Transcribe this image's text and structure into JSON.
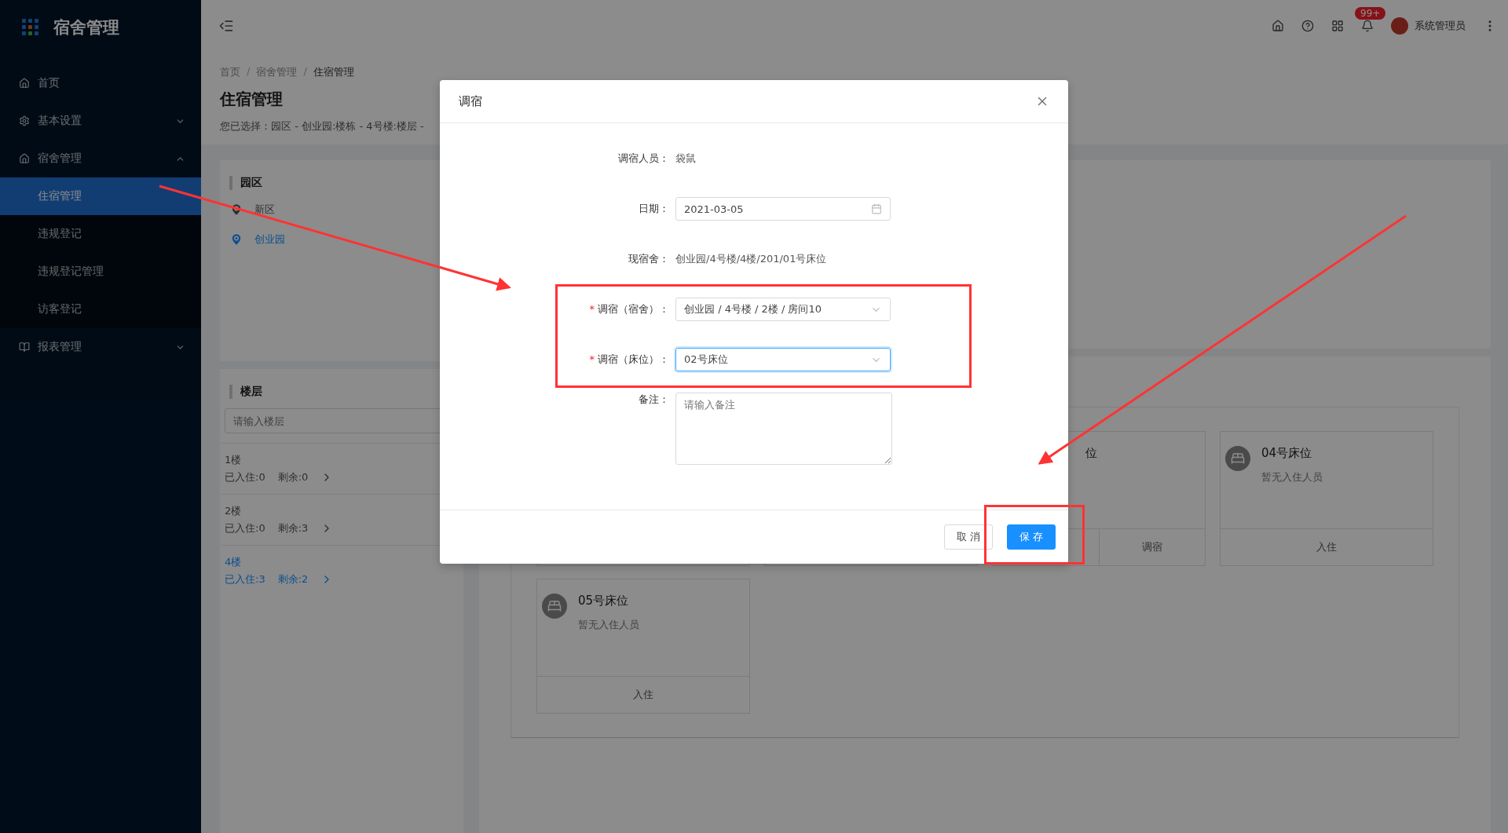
{
  "app": {
    "title": "宿舍管理"
  },
  "sidebar": {
    "items": [
      {
        "label": "首页"
      },
      {
        "label": "基本设置",
        "expanded": false
      },
      {
        "label": "宿舍管理",
        "expanded": true,
        "children": [
          {
            "label": "住宿管理",
            "selected": true
          },
          {
            "label": "违规登记",
            "selected": false
          },
          {
            "label": "违规登记管理",
            "selected": false
          },
          {
            "label": "访客登记",
            "selected": false
          }
        ]
      },
      {
        "label": "报表管理",
        "expanded": false
      }
    ]
  },
  "header": {
    "badge": "99+",
    "user": "系统管理员"
  },
  "breadcrumb": {
    "separator": "/",
    "items": [
      "首页",
      "宿舍管理",
      "住宿管理"
    ]
  },
  "page": {
    "title": "住宿管理",
    "selection": "您已选择：园区 - 创业园:楼栋 - 4号楼:楼层 -"
  },
  "park": {
    "title": "园区",
    "items": [
      {
        "label": "新区",
        "selected": false
      },
      {
        "label": "创业园",
        "selected": true
      }
    ]
  },
  "floor": {
    "title": "楼层",
    "placeholder": "请输入楼层",
    "items": [
      {
        "name": "1楼",
        "occupied": "已入住:0",
        "remaining": "剩余:0",
        "selected": false
      },
      {
        "name": "2楼",
        "occupied": "已入住:0",
        "remaining": "剩余:3",
        "selected": false
      },
      {
        "name": "4楼",
        "occupied": "已入住:3",
        "remaining": "剩余:2",
        "selected": true
      }
    ]
  },
  "beds": [
    {
      "title": "位",
      "clipped": true,
      "actions": [
        "调宿"
      ]
    },
    {
      "title": "04号床位",
      "status": "暂无入住人员",
      "clipped": false,
      "actions": [
        "入住"
      ]
    },
    {
      "title": "05号床位",
      "status": "暂无入住人员",
      "clipped": false,
      "actions": [
        "入住"
      ]
    }
  ],
  "dialog": {
    "title": "调宿",
    "fields": [
      {
        "kind": "text",
        "label": "调宿人员：",
        "value": "袋鼠"
      },
      {
        "kind": "date",
        "label": "日期：",
        "value": "2021-03-05"
      },
      {
        "kind": "text",
        "label": "现宿舍：",
        "value": "创业园/4号楼/4楼/201/01号床位"
      },
      {
        "kind": "select",
        "label": "调宿（宿舍）：",
        "value": "创业园 / 4号楼 / 2楼 / 房间10",
        "required_mark": "*",
        "focused": false
      },
      {
        "kind": "select",
        "label": "调宿（床位）：",
        "value": "02号床位",
        "required_mark": "*",
        "focused": true
      },
      {
        "kind": "textarea",
        "label": "备注：",
        "placeholder": "请输入备注"
      }
    ],
    "buttons": [
      {
        "label": "取 消",
        "primary": false
      },
      {
        "label": "保 存",
        "primary": true
      }
    ]
  }
}
